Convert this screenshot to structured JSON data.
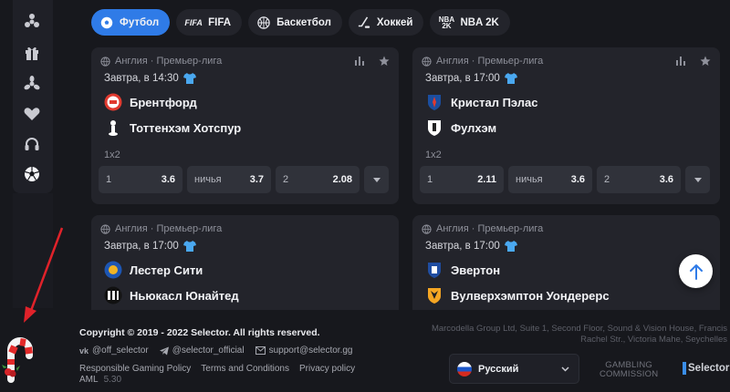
{
  "sidebar": {
    "icons": [
      "fidget-spinner-icon",
      "gift-icon",
      "propeller-icon",
      "heart-icon",
      "headset-icon",
      "soccer-ball-icon"
    ]
  },
  "tabs": [
    {
      "label": "Футбол",
      "icon": "soccer-ball-icon",
      "active": true
    },
    {
      "label": "FIFA",
      "icon": "fifa-logo-icon",
      "active": false
    },
    {
      "label": "Баскетбол",
      "icon": "basketball-icon",
      "active": false
    },
    {
      "label": "Хоккей",
      "icon": "hockey-icon",
      "active": false
    },
    {
      "label": "NBA 2K",
      "icon": "nba2k-logo-icon",
      "active": false
    }
  ],
  "matches": [
    {
      "country": "Англия",
      "league": "Премьер-лига",
      "date": "Завтра, в 14:30",
      "home": "Брентфорд",
      "away": "Тоттенхэм Хотспур",
      "market": "1x2",
      "odds": [
        {
          "label": "1",
          "value": "3.6"
        },
        {
          "label": "ничья",
          "value": "3.7"
        },
        {
          "label": "2",
          "value": "2.08"
        }
      ]
    },
    {
      "country": "Англия",
      "league": "Премьер-лига",
      "date": "Завтра, в 17:00",
      "home": "Кристал Пэлас",
      "away": "Фулхэм",
      "market": "1x2",
      "odds": [
        {
          "label": "1",
          "value": "2.11"
        },
        {
          "label": "ничья",
          "value": "3.6"
        },
        {
          "label": "2",
          "value": "3.6"
        }
      ]
    },
    {
      "country": "Англия",
      "league": "Премьер-лига",
      "date": "Завтра, в 17:00",
      "home": "Лестер Сити",
      "away": "Ньюкасл Юнайтед"
    },
    {
      "country": "Англия",
      "league": "Премьер-лига",
      "date": "Завтра, в 17:00",
      "home": "Эвертон",
      "away": "Вулверхэмптон Уондерерс"
    }
  ],
  "footer": {
    "copyright": "Copyright © 2019 - 2022 Selector. All rights reserved.",
    "socials": [
      "@off_selector",
      "@selector_official",
      "support@selector.gg"
    ],
    "links": [
      "Responsible Gaming Policy",
      "Terms and Conditions",
      "Privacy policy"
    ],
    "aml": "AML",
    "version": "5.30",
    "address_line1": "Marcodella Group Ltd, Suite 1, Second Floor, Sound & Vision House, Francis",
    "address_line2": "Rachel Str., Victoria Mahe, Seychelles",
    "language": "Русский",
    "gc_line1": "GAMBLING",
    "gc_line2": "COMMISSION",
    "brand": "Selector"
  },
  "colors": {
    "accent": "#2f7be7",
    "card": "#23242b",
    "background": "#17181d",
    "odd": "#30323a"
  }
}
